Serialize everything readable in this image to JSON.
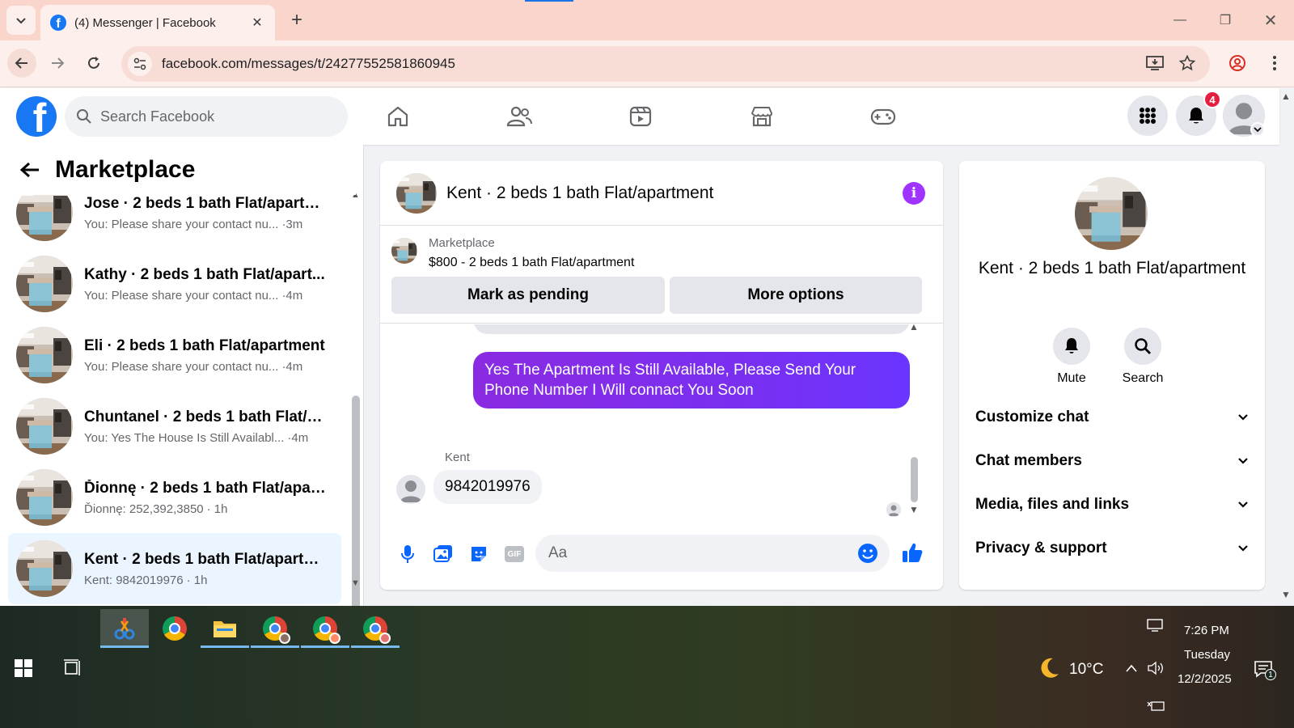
{
  "browser": {
    "tab_title": "(4) Messenger | Facebook",
    "url": "facebook.com/messages/t/24277552581860945"
  },
  "fb_header": {
    "search_placeholder": "Search Facebook",
    "notification_count": "4",
    "logo_letter": "f"
  },
  "left_pane": {
    "title": "Marketplace",
    "conversations": [
      {
        "name": "Jose · 2 beds 1 bath Flat/apartm...",
        "preview": "You: Please share your contact nu...",
        "time": "·3m"
      },
      {
        "name": "Kathy · 2 beds 1 bath Flat/apart...",
        "preview": "You: Please share your contact nu...",
        "time": "·4m"
      },
      {
        "name": "Eli · 2 beds 1 bath Flat/apartment",
        "preview": "You: Please share your contact nu...",
        "time": "·4m"
      },
      {
        "name": "Chuntanel · 2 beds 1 bath Flat/a...",
        "preview": "You: Yes The House Is Still Availabl...",
        "time": "·4m"
      },
      {
        "name": "Ďionnę · 2 beds 1 bath Flat/apar...",
        "preview": "Ďionnę: 252,392,3850",
        "time": "· 1h"
      },
      {
        "name": "Kent · 2 beds 1 bath Flat/apartm...",
        "preview": "Kent: 9842019976",
        "time": "· 1h"
      }
    ]
  },
  "chat": {
    "title": "Kent · 2 beds 1 bath Flat/apartment",
    "marketplace_label": "Marketplace",
    "listing": "$800 - 2 beds 1 bath Flat/apartment",
    "mark_pending_label": "Mark as pending",
    "more_options_label": "More options",
    "outgoing_message": "Yes The Apartment Is Still Available, Please Send Your Phone Number I Will connact You Soon",
    "incoming_sender": "Kent",
    "incoming_message": "9842019976",
    "composer_placeholder": "Aa",
    "gif_label": "GIF"
  },
  "info_panel": {
    "name": "Kent · 2 beds 1 bath Flat/apartment",
    "mute_label": "Mute",
    "search_label": "Search",
    "sections": [
      "Customize chat",
      "Chat members",
      "Media, files and links",
      "Privacy & support"
    ]
  },
  "taskbar": {
    "temperature": "10°C",
    "time": "7:26 PM",
    "day": "Tuesday",
    "date": "12/2/2025",
    "notification_count": "1"
  },
  "colors": {
    "fb_blue": "#1877f2",
    "messenger_purple": "#a033ff",
    "badge_red": "#e41e3f",
    "active_conv": "#ebf5ff"
  }
}
